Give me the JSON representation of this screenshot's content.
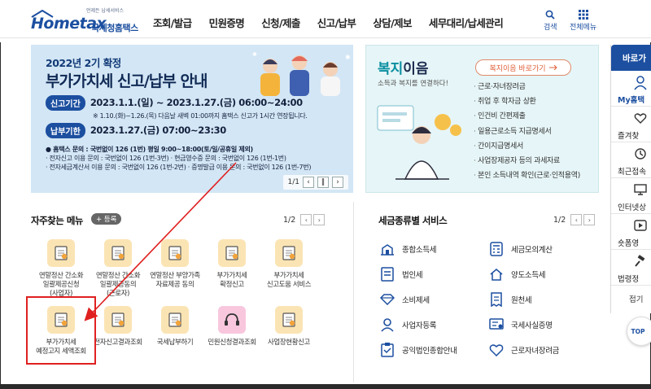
{
  "header": {
    "logo_tag": "언제든 납세서비스",
    "logo_text": "Hometax",
    "logo_kor": "국세청홈택스",
    "nav": [
      "조회/발급",
      "민원증명",
      "신청/제출",
      "신고/납부",
      "상담/제보",
      "세무대리/납세관리"
    ],
    "search_label": "검색",
    "menu_label": "전체메뉴"
  },
  "banner": {
    "subtitle": "2022년 2기 확정",
    "title": "부가가치세 신고/납부 안내",
    "period_label": "신고기간",
    "period_text": "2023.1.1.(일) ~ 2023.1.27.(금) 06:00~24:00",
    "period_note": "※ 1.10.(화)~1.26.(목) 다음날 새벽 01:00까지 홈택스 신고가 1시간 연장됩니다.",
    "deadline_label": "납부기한",
    "deadline_text": "2023.1.27.(금) 07:00~23:30",
    "notes": [
      "● 홈택스 문의 : 국번없이 126 (1번) 평일 9:00~18:00(토/일/공휴일 제외)",
      "· 전자신고 이용 문의 : 국번없이 126 (1번-3번)     · 현금영수증 문의 : 국번없이 126 (1번-1번)",
      "· 전자세금계산서 이용 문의 : 국번없이 126 (1번-2번)   · 증명발급 이용 문의 : 국번없이 126 (1번-7번)"
    ],
    "page": "1/1"
  },
  "welfare": {
    "title_accent": "복지",
    "title_rest": "이음",
    "desc": "소득과 복지를 연결하다!",
    "go_label": "복지이음 바로가기",
    "items": [
      "근로·자녀장려금",
      "취업 후 학자금 상환",
      "인건비 간편제출",
      "일용근로소득 지급명세서",
      "간이지급명세서",
      "사업장제공자 등의 과세자료",
      "본인 소득내역 확인(근로·인적용역)"
    ]
  },
  "quick": {
    "top": "바로가",
    "items": [
      "My홈택",
      "즐겨찾",
      "최근접속",
      "인터넷상",
      "숏폼영",
      "법령정"
    ],
    "fold": "접기",
    "top_btn": "TOP"
  },
  "favorites": {
    "title": "자주찾는 메뉴",
    "add_label": "+ 등록",
    "page": "1/2",
    "items": [
      {
        "lines": [
          "연말정산 간소화",
          "일괄제공신청",
          "(사업자)"
        ],
        "color": "orange"
      },
      {
        "lines": [
          "연말정산 간소화",
          "일괄제공동의",
          "(근로자)"
        ],
        "color": "orange"
      },
      {
        "lines": [
          "연말정산 부양가족",
          "자료제공 동의"
        ],
        "color": "orange"
      },
      {
        "lines": [
          "부가가치세",
          "확정신고"
        ],
        "color": "orange"
      },
      {
        "lines": [
          "부가가치세",
          "신고도움 서비스"
        ],
        "color": "orange"
      },
      {
        "lines": [
          "부가가치세",
          "예정고지 세액조회"
        ],
        "color": "orange"
      },
      {
        "lines": [
          "전자신고결과조회"
        ],
        "color": "orange"
      },
      {
        "lines": [
          "국세납부하기"
        ],
        "color": "orange"
      },
      {
        "lines": [
          "민원신청결과조회"
        ],
        "color": "pink"
      },
      {
        "lines": [
          "사업장현황신고"
        ],
        "color": "orange"
      }
    ]
  },
  "tax_service": {
    "title": "세금종류별 서비스",
    "page": "1/2",
    "items": [
      "종합소득세",
      "세금모의계산",
      "법인세",
      "양도소득세",
      "소비제세",
      "원천세",
      "사업자등록",
      "국세사실증명",
      "공익법인종합안내",
      "근로자녀장려금"
    ]
  },
  "colors": {
    "brand": "#1c4fa0",
    "welfare": "#0a8fa0",
    "highlight": "#e02020"
  }
}
